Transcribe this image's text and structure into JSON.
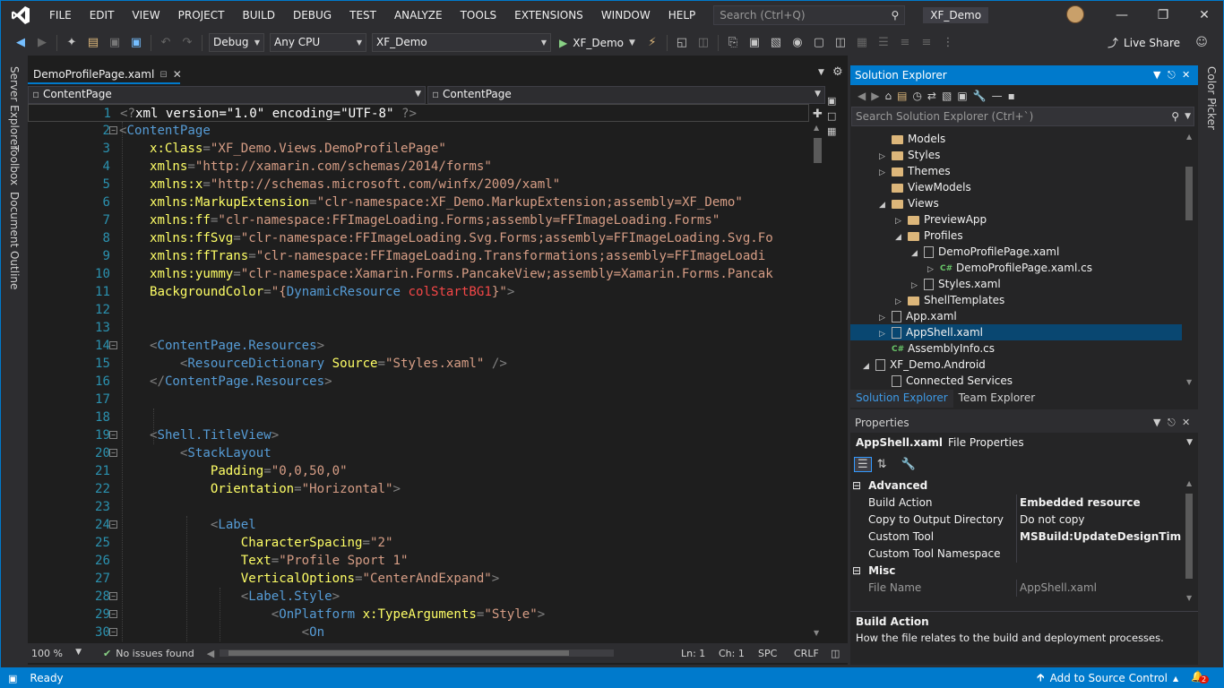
{
  "menu": [
    "FILE",
    "EDIT",
    "VIEW",
    "PROJECT",
    "BUILD",
    "DEBUG",
    "TEST",
    "ANALYZE",
    "TOOLS",
    "EXTENSIONS",
    "WINDOW",
    "HELP"
  ],
  "search": {
    "placeholder": "Search (Ctrl+Q)"
  },
  "solution_name": "XF_Demo",
  "toolbar": {
    "config": "Debug",
    "platform": "Any CPU",
    "project": "XF_Demo",
    "run_target": "XF_Demo",
    "live_share": "Live Share"
  },
  "left_tabs": [
    "Server Explorer",
    "Toolbox",
    "Document Outline"
  ],
  "right_tabs": [
    "Color Picker"
  ],
  "editor": {
    "tab_title": "DemoProfilePage.xaml",
    "nav_left": "ContentPage",
    "nav_right": "ContentPage",
    "zoom": "100 %",
    "issues": "No issues found",
    "ln": "Ln: 1",
    "ch": "Ch: 1",
    "spc": "SPC",
    "crlf": "CRLF"
  },
  "code_lines": [
    {
      "n": "1",
      "seg": [
        [
          "b",
          "<?"
        ],
        [
          "x",
          "xml version=\"1.0\" encoding=\"UTF-8\" "
        ],
        [
          "b",
          "?>"
        ]
      ]
    },
    {
      "n": "2",
      "seg": [
        [
          "b",
          "<"
        ],
        [
          "el",
          "ContentPage"
        ]
      ]
    },
    {
      "n": "3",
      "seg": [
        [
          "p",
          "    "
        ],
        [
          "at",
          "x:Class"
        ],
        [
          "b",
          "="
        ],
        [
          "v",
          "\"XF_Demo.Views.DemoProfilePage\""
        ]
      ]
    },
    {
      "n": "4",
      "seg": [
        [
          "p",
          "    "
        ],
        [
          "at",
          "xmlns"
        ],
        [
          "b",
          "="
        ],
        [
          "v",
          "\"http://xamarin.com/schemas/2014/forms\""
        ]
      ]
    },
    {
      "n": "5",
      "seg": [
        [
          "p",
          "    "
        ],
        [
          "at",
          "xmlns:x"
        ],
        [
          "b",
          "="
        ],
        [
          "v",
          "\"http://schemas.microsoft.com/winfx/2009/xaml\""
        ]
      ]
    },
    {
      "n": "6",
      "seg": [
        [
          "p",
          "    "
        ],
        [
          "at",
          "xmlns:MarkupExtension"
        ],
        [
          "b",
          "="
        ],
        [
          "v",
          "\"clr-namespace:XF_Demo.MarkupExtension;assembly=XF_Demo\""
        ]
      ]
    },
    {
      "n": "7",
      "seg": [
        [
          "p",
          "    "
        ],
        [
          "at",
          "xmlns:ff"
        ],
        [
          "b",
          "="
        ],
        [
          "v",
          "\"clr-namespace:FFImageLoading.Forms;assembly=FFImageLoading.Forms\""
        ]
      ]
    },
    {
      "n": "8",
      "seg": [
        [
          "p",
          "    "
        ],
        [
          "at",
          "xmlns:ffSvg"
        ],
        [
          "b",
          "="
        ],
        [
          "v",
          "\"clr-namespace:FFImageLoading.Svg.Forms;assembly=FFImageLoading.Svg.Fo"
        ]
      ]
    },
    {
      "n": "9",
      "seg": [
        [
          "p",
          "    "
        ],
        [
          "at",
          "xmlns:ffTrans"
        ],
        [
          "b",
          "="
        ],
        [
          "v",
          "\"clr-namespace:FFImageLoading.Transformations;assembly=FFImageLoadi"
        ]
      ]
    },
    {
      "n": "10",
      "seg": [
        [
          "p",
          "    "
        ],
        [
          "at",
          "xmlns:yummy"
        ],
        [
          "b",
          "="
        ],
        [
          "v",
          "\"clr-namespace:Xamarin.Forms.PancakeView;assembly=Xamarin.Forms.Pancak"
        ]
      ]
    },
    {
      "n": "11",
      "seg": [
        [
          "p",
          "    "
        ],
        [
          "at",
          "BackgroundColor"
        ],
        [
          "b",
          "="
        ],
        [
          "v",
          "\"{"
        ],
        [
          "dr",
          "DynamicResource"
        ],
        [
          "p",
          " "
        ],
        [
          "rk",
          "colStartBG1"
        ],
        [
          "v",
          "}\""
        ],
        [
          "b",
          ">"
        ]
      ]
    },
    {
      "n": "12",
      "seg": []
    },
    {
      "n": "13",
      "seg": []
    },
    {
      "n": "14",
      "seg": [
        [
          "p",
          "    "
        ],
        [
          "b",
          "<"
        ],
        [
          "el",
          "ContentPage.Resources"
        ],
        [
          "b",
          ">"
        ]
      ]
    },
    {
      "n": "15",
      "seg": [
        [
          "p",
          "        "
        ],
        [
          "b",
          "<"
        ],
        [
          "el",
          "ResourceDictionary"
        ],
        [
          "p",
          " "
        ],
        [
          "at",
          "Source"
        ],
        [
          "b",
          "="
        ],
        [
          "v",
          "\"Styles.xaml\""
        ],
        [
          "p",
          " "
        ],
        [
          "b",
          "/>"
        ]
      ]
    },
    {
      "n": "16",
      "seg": [
        [
          "p",
          "    "
        ],
        [
          "b",
          "</"
        ],
        [
          "el",
          "ContentPage.Resources"
        ],
        [
          "b",
          ">"
        ]
      ]
    },
    {
      "n": "17",
      "seg": []
    },
    {
      "n": "18",
      "seg": []
    },
    {
      "n": "19",
      "seg": [
        [
          "p",
          "    "
        ],
        [
          "b",
          "<"
        ],
        [
          "el",
          "Shell.TitleView"
        ],
        [
          "b",
          ">"
        ]
      ]
    },
    {
      "n": "20",
      "seg": [
        [
          "p",
          "        "
        ],
        [
          "b",
          "<"
        ],
        [
          "el",
          "StackLayout"
        ]
      ]
    },
    {
      "n": "21",
      "seg": [
        [
          "p",
          "            "
        ],
        [
          "at",
          "Padding"
        ],
        [
          "b",
          "="
        ],
        [
          "v",
          "\"0,0,50,0\""
        ]
      ]
    },
    {
      "n": "22",
      "seg": [
        [
          "p",
          "            "
        ],
        [
          "at",
          "Orientation"
        ],
        [
          "b",
          "="
        ],
        [
          "v",
          "\"Horizontal\""
        ],
        [
          "b",
          ">"
        ]
      ]
    },
    {
      "n": "23",
      "seg": []
    },
    {
      "n": "24",
      "seg": [
        [
          "p",
          "            "
        ],
        [
          "b",
          "<"
        ],
        [
          "el",
          "Label"
        ]
      ]
    },
    {
      "n": "25",
      "seg": [
        [
          "p",
          "                "
        ],
        [
          "at",
          "CharacterSpacing"
        ],
        [
          "b",
          "="
        ],
        [
          "v",
          "\"2\""
        ]
      ]
    },
    {
      "n": "26",
      "seg": [
        [
          "p",
          "                "
        ],
        [
          "at",
          "Text"
        ],
        [
          "b",
          "="
        ],
        [
          "v",
          "\"Profile Sport 1\""
        ]
      ]
    },
    {
      "n": "27",
      "seg": [
        [
          "p",
          "                "
        ],
        [
          "at",
          "VerticalOptions"
        ],
        [
          "b",
          "="
        ],
        [
          "v",
          "\"CenterAndExpand\""
        ],
        [
          "b",
          ">"
        ]
      ]
    },
    {
      "n": "28",
      "seg": [
        [
          "p",
          "                "
        ],
        [
          "b",
          "<"
        ],
        [
          "el",
          "Label.Style"
        ],
        [
          "b",
          ">"
        ]
      ]
    },
    {
      "n": "29",
      "seg": [
        [
          "p",
          "                    "
        ],
        [
          "b",
          "<"
        ],
        [
          "el",
          "OnPlatform"
        ],
        [
          "p",
          " "
        ],
        [
          "at",
          "x:TypeArguments"
        ],
        [
          "b",
          "="
        ],
        [
          "v",
          "\"Style\""
        ],
        [
          "b",
          ">"
        ]
      ]
    },
    {
      "n": "30",
      "seg": [
        [
          "p",
          "                        "
        ],
        [
          "b",
          "<"
        ],
        [
          "el",
          "On"
        ]
      ]
    }
  ],
  "solution_explorer": {
    "title": "Solution Explorer",
    "search_placeholder": "Search Solution Explorer (Ctrl+`)",
    "tree": [
      {
        "label": "Models",
        "kind": "folder",
        "indent": 2,
        "exp": ""
      },
      {
        "label": "Styles",
        "kind": "folder",
        "indent": 2,
        "exp": "▷"
      },
      {
        "label": "Themes",
        "kind": "folder",
        "indent": 2,
        "exp": "▷"
      },
      {
        "label": "ViewModels",
        "kind": "folder",
        "indent": 2,
        "exp": ""
      },
      {
        "label": "Views",
        "kind": "folder",
        "indent": 2,
        "exp": "◢"
      },
      {
        "label": "PreviewApp",
        "kind": "folder",
        "indent": 3,
        "exp": "▷"
      },
      {
        "label": "Profiles",
        "kind": "folder",
        "indent": 3,
        "exp": "◢"
      },
      {
        "label": "DemoProfilePage.xaml",
        "kind": "file",
        "indent": 4,
        "exp": "◢"
      },
      {
        "label": "DemoProfilePage.xaml.cs",
        "kind": "cs",
        "indent": 5,
        "exp": "▷"
      },
      {
        "label": "Styles.xaml",
        "kind": "file",
        "indent": 4,
        "exp": "▷"
      },
      {
        "label": "ShellTemplates",
        "kind": "folder",
        "indent": 3,
        "exp": "▷"
      },
      {
        "label": "App.xaml",
        "kind": "file",
        "indent": 2,
        "exp": "▷"
      },
      {
        "label": "AppShell.xaml",
        "kind": "file",
        "indent": 2,
        "exp": "▷",
        "selected": true
      },
      {
        "label": "AssemblyInfo.cs",
        "kind": "cs",
        "indent": 2,
        "exp": ""
      },
      {
        "label": "XF_Demo.Android",
        "kind": "file",
        "indent": 1,
        "exp": "◢"
      },
      {
        "label": "Connected Services",
        "kind": "file",
        "indent": 2,
        "exp": ""
      }
    ],
    "bottom_tabs": [
      "Solution Explorer",
      "Team Explorer"
    ]
  },
  "properties": {
    "title": "Properties",
    "object": "AppShell.xaml",
    "object_type": "File Properties",
    "categories": [
      {
        "name": "Advanced",
        "rows": [
          {
            "k": "Build Action",
            "v": "Embedded resource",
            "bold": true
          },
          {
            "k": "Copy to Output Directory",
            "v": "Do not copy",
            "bold": false
          },
          {
            "k": "Custom Tool",
            "v": "MSBuild:UpdateDesignTimeXam",
            "bold": true
          },
          {
            "k": "Custom Tool Namespace",
            "v": "",
            "bold": false
          }
        ]
      },
      {
        "name": "Misc",
        "rows": [
          {
            "k": "File Name",
            "v": "AppShell.xaml",
            "bold": false,
            "dim": true
          }
        ]
      }
    ],
    "desc_title": "Build Action",
    "desc_text": "How the file relates to the build and deployment processes."
  },
  "status": {
    "ready": "Ready",
    "source_control": "Add to Source Control",
    "notif_count": "2"
  },
  "colors": {
    "accent": "#007acc",
    "selection": "#094771"
  }
}
